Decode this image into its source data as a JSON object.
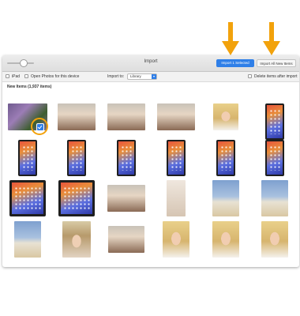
{
  "toolbar": {
    "title": "Import",
    "import_selected_label": "Import 1 Selected",
    "import_all_label": "Import All New Items"
  },
  "options": {
    "device_name": "iPad",
    "open_photos_label": "Open Photos for this device",
    "import_to_label": "Import to:",
    "import_to_value": "Library",
    "delete_label": "Delete items after import"
  },
  "section": {
    "header": "New Items (1,937 items)"
  },
  "annotations": {
    "arrow_color": "#f2a20c",
    "accent": "#2f7fe8"
  },
  "photos": {
    "selected_count": 1,
    "kinds": [
      "flowers",
      "people",
      "people",
      "people",
      "face",
      "phone",
      "phone",
      "phone",
      "phone",
      "phone",
      "phone",
      "phone",
      "phone",
      "phone",
      "people",
      "roomy",
      "beach",
      "beach",
      "beach",
      "hat",
      "people",
      "face",
      "face",
      "face"
    ]
  }
}
